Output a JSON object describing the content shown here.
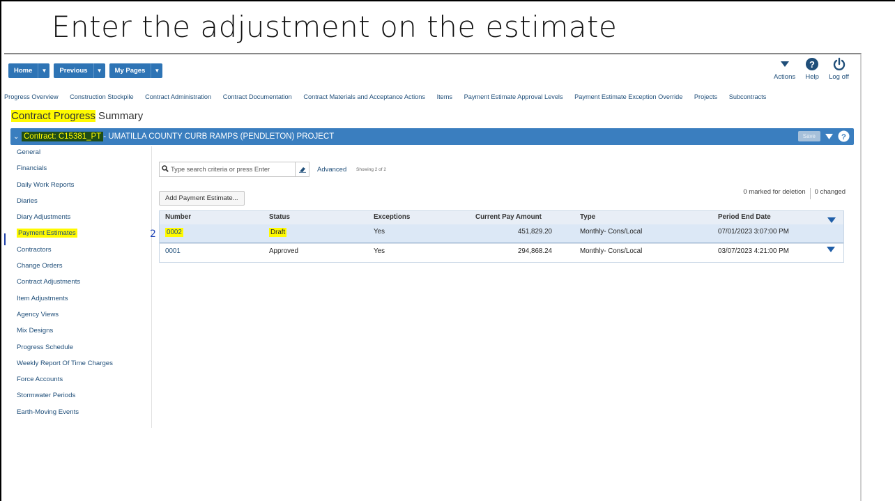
{
  "slide": {
    "title": "Enter the adjustment on the estimate"
  },
  "toolbar": {
    "nav_buttons": [
      "Home",
      "Previous",
      "My Pages"
    ],
    "actions_label": "Actions",
    "help_label": "Help",
    "logoff_label": "Log off"
  },
  "links": [
    "Progress Overview",
    "Construction Stockpile",
    "Contract Administration",
    "Contract Documentation",
    "Contract Materials and Acceptance Actions",
    "Items",
    "Payment Estimate Approval Levels",
    "Payment Estimate Exception Override",
    "Projects",
    "Subcontracts"
  ],
  "heading": {
    "highlight": "Contract Progress",
    "rest": " Summary"
  },
  "contract_bar": {
    "id": "Contract: C15381_PT",
    "name": " - UMATILLA COUNTY CURB RAMPS (PENDLETON) PROJECT",
    "save_label": "Save"
  },
  "sidebar": {
    "items": [
      "General",
      "Financials",
      "Daily Work Reports",
      "Diaries",
      "Diary Adjustments",
      "Payment Estimates",
      "Contractors",
      "Change Orders",
      "Contract Adjustments",
      "Item Adjustments",
      "Agency Views",
      "Mix Designs",
      "Progress Schedule",
      "Weekly Report Of Time Charges",
      "Force Accounts",
      "Stormwater Periods",
      "Earth-Moving Events"
    ],
    "active": "Payment Estimates"
  },
  "search": {
    "placeholder": "Type search criteria or press Enter",
    "advanced_label": "Advanced",
    "showing": "Showing 2 of 2"
  },
  "add_button": "Add Payment Estimate...",
  "counts": {
    "marked": "0 marked for deletion",
    "changed": "0 changed"
  },
  "table": {
    "headers": [
      "Number",
      "Status",
      "Exceptions",
      "Current Pay Amount",
      "Type",
      "Period End Date"
    ],
    "rows": [
      {
        "number": "0002",
        "status": "Draft",
        "exceptions": "Yes",
        "amount": "451,829.20",
        "type": "Monthly- Cons/Local",
        "date": "07/01/2023 3:07:00 PM"
      },
      {
        "number": "0001",
        "status": "Approved",
        "exceptions": "Yes",
        "amount": "294,868.24",
        "type": "Monthly- Cons/Local",
        "date": "03/07/2023 4:21:00 PM"
      }
    ]
  },
  "annotation_marker": "2",
  "colors": {
    "accent": "#3a7ebf",
    "highlight": "#fffa00",
    "link": "#1f4e79"
  }
}
